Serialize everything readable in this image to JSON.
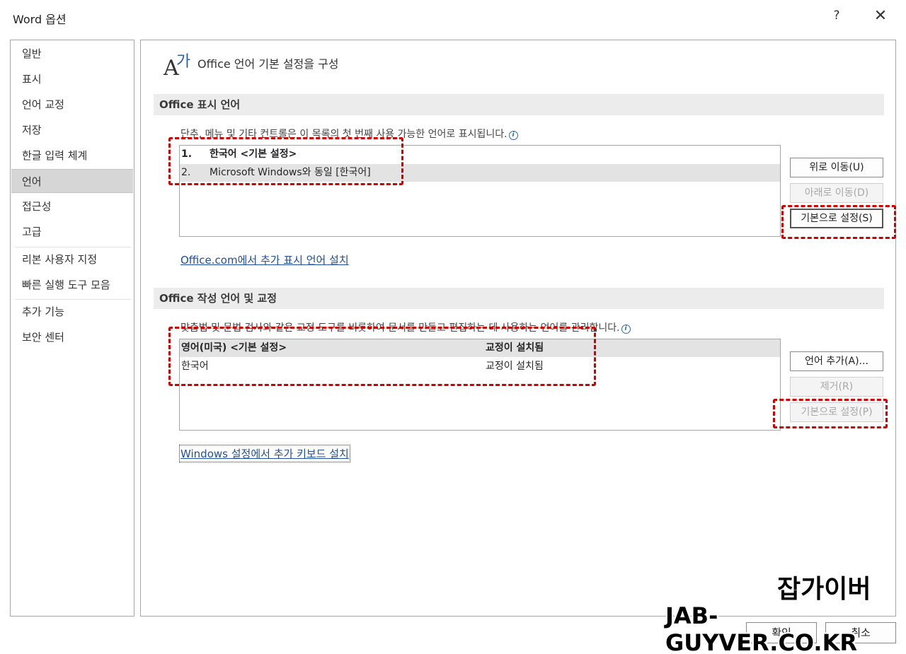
{
  "window": {
    "title": "Word 옵션",
    "help_label": "?",
    "close_label": "✕"
  },
  "sidebar": {
    "items": [
      {
        "label": "일반"
      },
      {
        "label": "표시"
      },
      {
        "label": "언어 교정"
      },
      {
        "label": "저장"
      },
      {
        "label": "한글 입력 체계"
      },
      {
        "label": "언어",
        "selected": true
      },
      {
        "label": "접근성"
      },
      {
        "label": "고급"
      },
      {
        "label": "리본 사용자 지정"
      },
      {
        "label": "빠른 실행 도구 모음"
      },
      {
        "label": "추가 기능"
      },
      {
        "label": "보안 센터"
      }
    ]
  },
  "header": {
    "icon_latin": "A",
    "icon_hangul": "가",
    "title": "Office 언어 기본 설정을 구성"
  },
  "display_language": {
    "section_title": "Office 표시 언어",
    "description": "단추, 메뉴 및 기타 컨트롤은 이 목록의 첫 번째 사용 가능한 언어로 표시됩니다.",
    "rows": [
      {
        "num": "1.",
        "text": "한국어 <기본 설정>"
      },
      {
        "num": "2.",
        "text": "Microsoft Windows와 동일 [한국어]"
      }
    ],
    "buttons": {
      "move_up": "위로 이동(U)",
      "move_down": "아래로 이동(D)",
      "set_default": "기본으로 설정(S)"
    },
    "link": "Office.com에서 추가 표시 언어 설치"
  },
  "authoring_language": {
    "section_title": "Office 작성 언어 및 교정",
    "description": "맞춤법 및 문법 검사와 같은 교정 도구를 비롯하여 문서를 만들고 편집하는 데 사용하는 언어를 관리합니다.",
    "rows": [
      {
        "language": "영어(미국) <기본 설정>",
        "status": "교정이 설치됨"
      },
      {
        "language": "한국어",
        "status": "교정이 설치됨"
      }
    ],
    "buttons": {
      "add_language": "언어 추가(A)...",
      "remove": "제거(R)",
      "set_default": "기본으로 설정(P)"
    },
    "link": "Windows 설정에서 추가 키보드 설치"
  },
  "footer": {
    "ok_label": "확인",
    "cancel_label": "취소"
  },
  "watermark": {
    "line1": "잡가이버",
    "line2": "JAB-GUYVER.CO.KR"
  },
  "colors": {
    "annotation": "#d10000",
    "link": "#1f4fa0",
    "selection": "#d6d6d6"
  }
}
